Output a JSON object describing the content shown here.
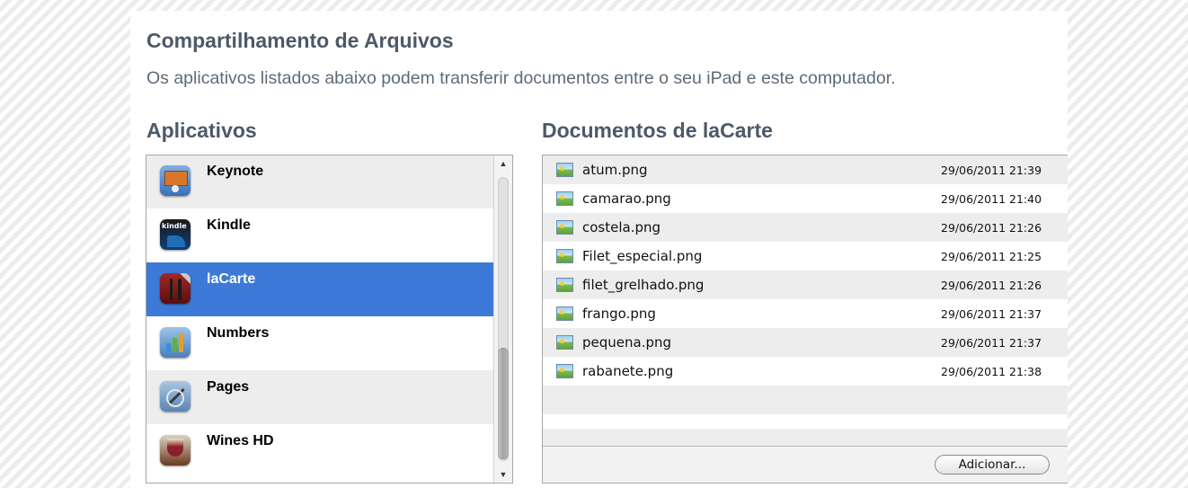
{
  "header": {
    "title": "Compartilhamento de Arquivos",
    "subtitle": "Os aplicativos listados abaixo podem transferir documentos entre o seu iPad e este computador."
  },
  "apps_panel": {
    "heading": "Aplicativos",
    "selected": "laCarte",
    "items": [
      {
        "name": "Keynote",
        "icon": "keynote-icon"
      },
      {
        "name": "Kindle",
        "icon": "kindle-icon",
        "icon_text": "kindle"
      },
      {
        "name": "laCarte",
        "icon": "lacarte-icon"
      },
      {
        "name": "Numbers",
        "icon": "numbers-icon"
      },
      {
        "name": "Pages",
        "icon": "pages-icon"
      },
      {
        "name": "Wines HD",
        "icon": "wines-hd-icon"
      }
    ]
  },
  "docs_panel": {
    "heading": "Documentos de laCarte",
    "files": [
      {
        "name": "atum.png",
        "date": "29/06/2011 21:39"
      },
      {
        "name": "camarao.png",
        "date": "29/06/2011 21:40"
      },
      {
        "name": "costela.png",
        "date": "29/06/2011 21:26"
      },
      {
        "name": "Filet_especial.png",
        "date": "29/06/2011 21:25"
      },
      {
        "name": "filet_grelhado.png",
        "date": "29/06/2011 21:26"
      },
      {
        "name": "frango.png",
        "date": "29/06/2011 21:37"
      },
      {
        "name": "pequena.png",
        "date": "29/06/2011 21:37"
      },
      {
        "name": "rabanete.png",
        "date": "29/06/2011 21:38"
      }
    ],
    "add_button": "Adicionar..."
  },
  "colors": {
    "selection": "#3d7ad8",
    "heading": "#4c5968",
    "row_alt": "#ededed"
  }
}
